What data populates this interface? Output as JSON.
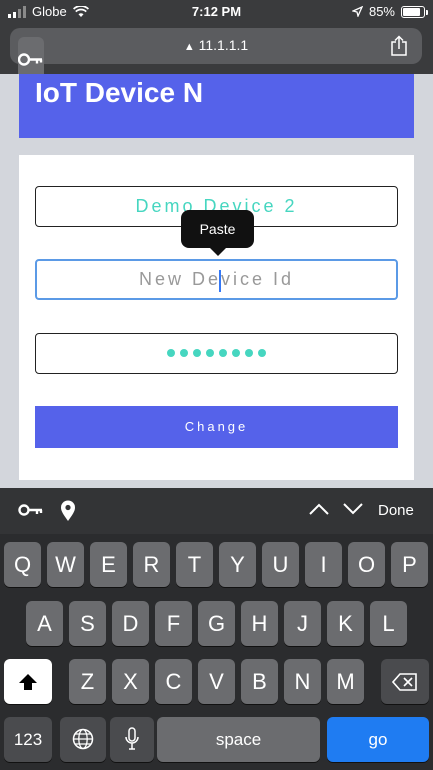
{
  "status_bar": {
    "carrier": "Globe",
    "time": "7:12 PM",
    "battery": "85%",
    "battery_level": 0.85
  },
  "browser": {
    "url": "11.1.1.1"
  },
  "page": {
    "title": "IoT Device N",
    "current_device_value": "Demo Device 2",
    "new_device_placeholder": "New Device Id",
    "password_length": 8,
    "change_button": "Change"
  },
  "popup": {
    "paste_label": "Paste"
  },
  "accessory_bar": {
    "done_label": "Done"
  },
  "keyboard": {
    "row1": [
      "Q",
      "W",
      "E",
      "R",
      "T",
      "Y",
      "U",
      "I",
      "O",
      "P"
    ],
    "row2": [
      "A",
      "S",
      "D",
      "F",
      "G",
      "H",
      "J",
      "K",
      "L"
    ],
    "row3": [
      "Z",
      "X",
      "C",
      "V",
      "B",
      "N",
      "M"
    ],
    "numbers_key": "123",
    "space_key": "space",
    "go_key": "go"
  }
}
